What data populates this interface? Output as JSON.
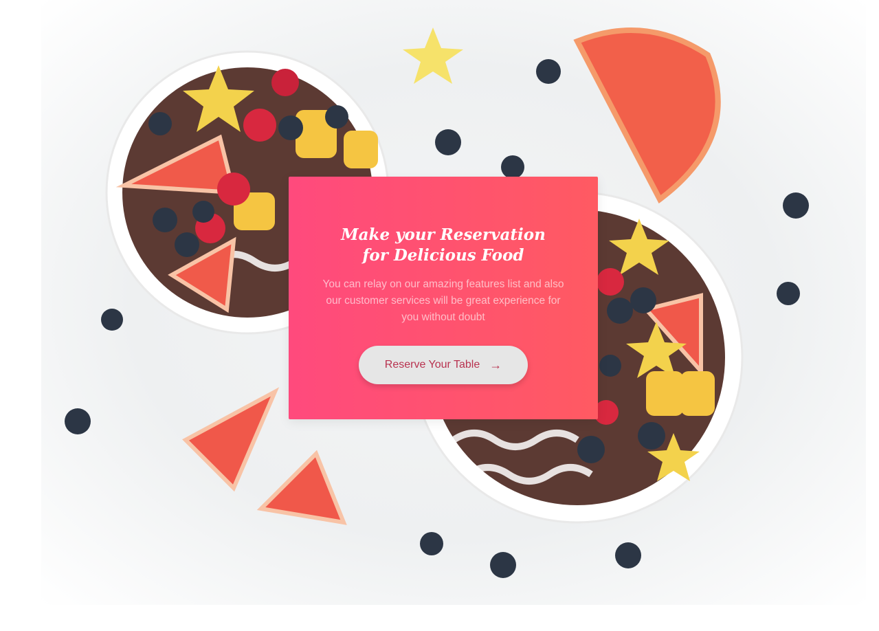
{
  "reservation": {
    "title": "Make your Reservation for Delicious Food",
    "description": "You can relay on our amazing features list and also our customer services will be great experience for you without doubt",
    "button_label": "Reserve Your Table",
    "button_icon": "arrow-right-icon"
  },
  "colors": {
    "card_gradient_start": "#ff4a7d",
    "card_gradient_end": "#ff5a62",
    "button_bg": "#e6e6e6",
    "button_text": "#b8324f"
  }
}
